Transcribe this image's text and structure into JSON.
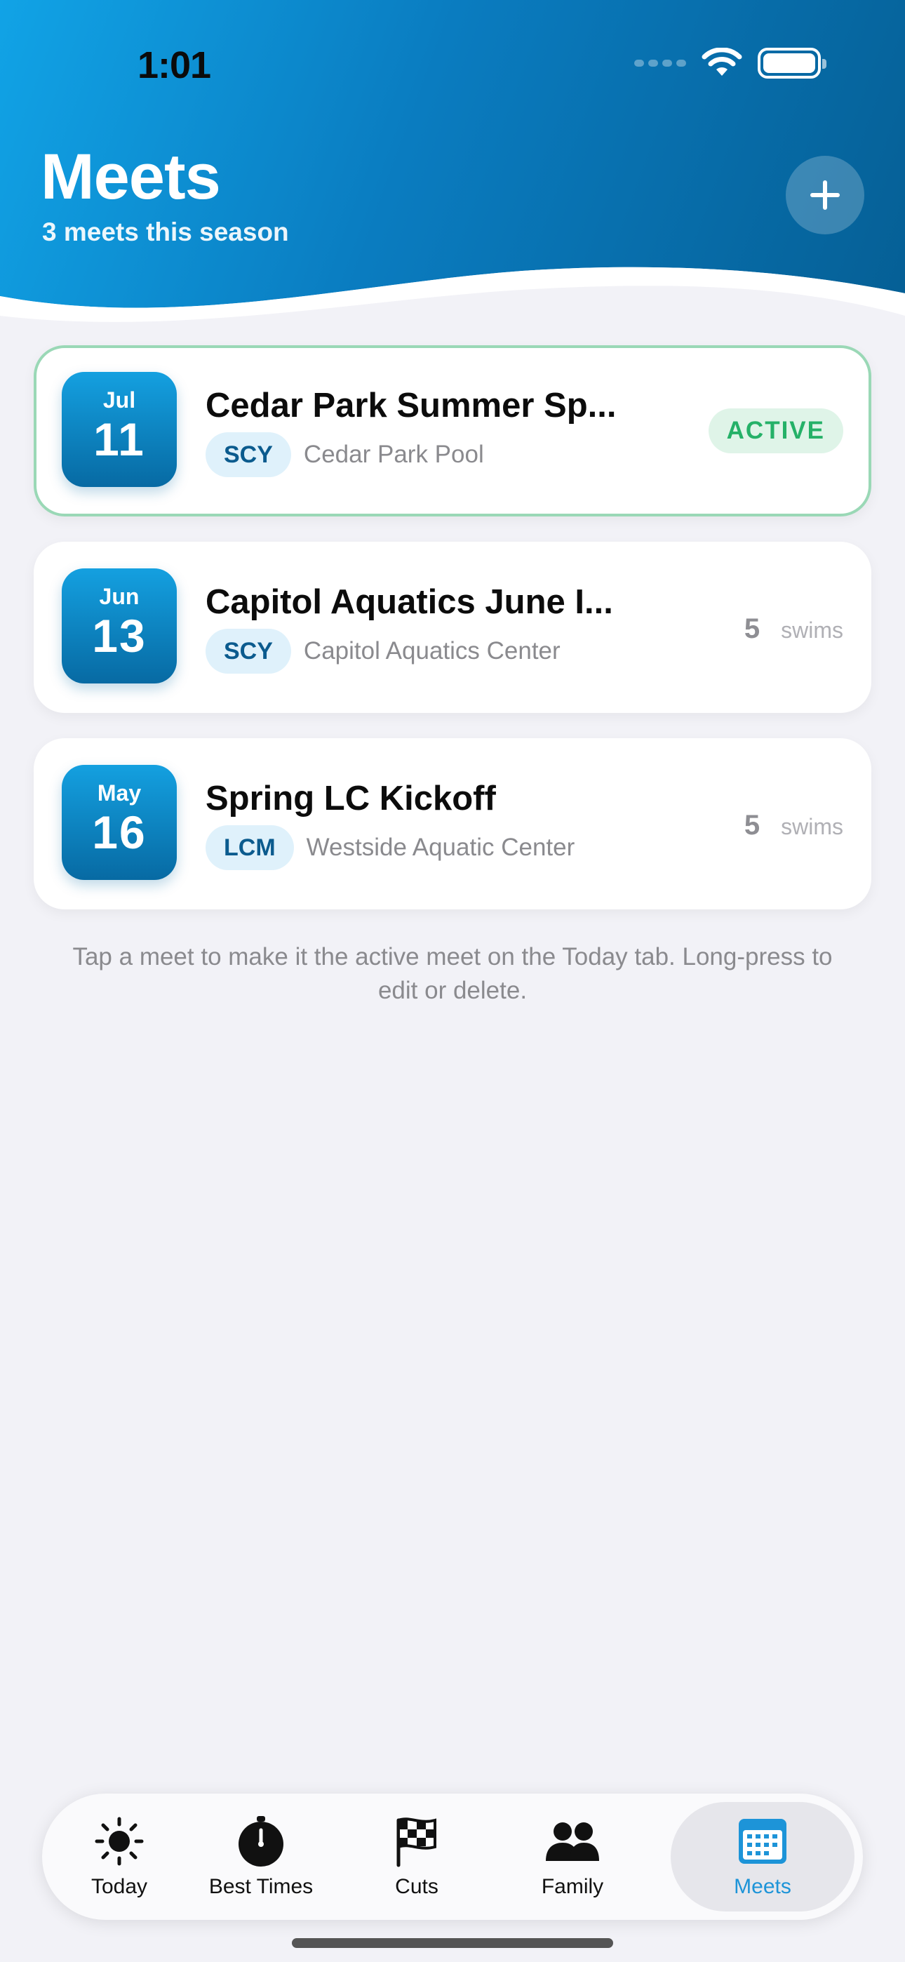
{
  "status_bar": {
    "time": "1:01"
  },
  "header": {
    "title": "Meets",
    "subtitle": "3 meets this season",
    "add_icon": "plus-icon"
  },
  "meets": [
    {
      "month": "Jul",
      "day": "11",
      "name": "Cedar Park Summer Sp...",
      "course": "SCY",
      "venue": "Cedar Park Pool",
      "status": "ACTIVE"
    },
    {
      "month": "Jun",
      "day": "13",
      "name": "Capitol Aquatics June I...",
      "course": "SCY",
      "venue": "Capitol Aquatics Center",
      "swims": "5",
      "swims_label": "swims"
    },
    {
      "month": "May",
      "day": "16",
      "name": "Spring LC Kickoff",
      "course": "LCM",
      "venue": "Westside Aquatic Center",
      "swims": "5",
      "swims_label": "swims"
    }
  ],
  "hint": "Tap a meet to make it the active meet on the Today tab. Long-press to edit or delete.",
  "tabs": [
    {
      "label": "Today",
      "icon": "sun-icon"
    },
    {
      "label": "Best Times",
      "icon": "stopwatch-icon"
    },
    {
      "label": "Cuts",
      "icon": "checkered-flag-icon"
    },
    {
      "label": "Family",
      "icon": "people-icon"
    },
    {
      "label": "Meets",
      "icon": "calendar-icon",
      "selected": true
    }
  ],
  "colors": {
    "header_gradient_start": "#11a3e6",
    "header_gradient_end": "#055f95",
    "active_green": "#25b168",
    "selected_tab_blue": "#1d94d8",
    "chip_text": "#0b5b8e"
  }
}
